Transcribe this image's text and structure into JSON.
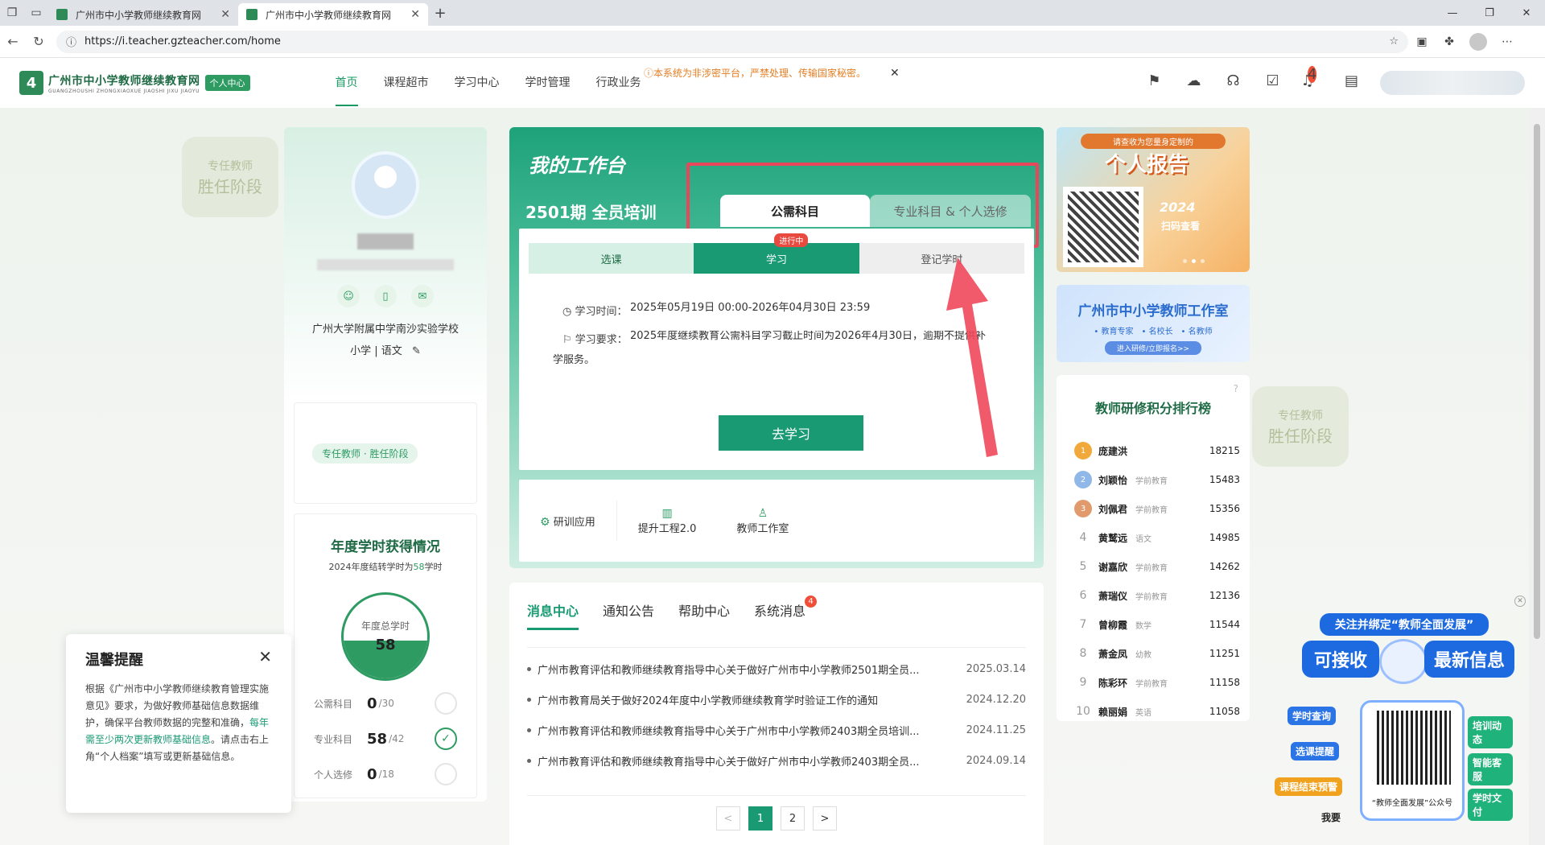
{
  "browser": {
    "tabs": [
      {
        "title": "广州市中小学教师继续教育网"
      },
      {
        "title": "广州市中小学教师继续教育网"
      }
    ],
    "url": "https://i.teacher.gzteacher.com/home"
  },
  "header": {
    "logo_cn": "广州市中小学教师继续教育网",
    "logo_en": "GUANGZHOUSHI ZHONGXIAOXUE JIAOSHI JIXU JIAOYU",
    "badge": "个人中心",
    "nav": [
      {
        "label": "首页",
        "active": true
      },
      {
        "label": "课程超市"
      },
      {
        "label": "学习中心"
      },
      {
        "label": "学时管理"
      },
      {
        "label": "行政业务"
      }
    ],
    "notice": "本系统为非涉密平台，严禁处理、传输国家秘密。",
    "notif_count": "4"
  },
  "watermark": {
    "line1": "专任教师",
    "line2": "胜任阶段"
  },
  "profile": {
    "school": "广州大学附属中学南沙实验学校",
    "subject": "小学 | 语文",
    "stage": "专任教师 · 胜任阶段",
    "annual_title": "年度学时获得情况",
    "annual_sub_prefix": "2024年度结转学时为",
    "annual_sub_value": "58",
    "annual_sub_suffix": "学时",
    "total_label": "年度总学时",
    "total_value": "58",
    "stats": [
      {
        "label": "公需科目",
        "value": "0",
        "total": "/30",
        "done": false
      },
      {
        "label": "专业科目",
        "value": "58",
        "total": "/42",
        "done": true
      },
      {
        "label": "个人选修",
        "value": "0",
        "total": "/18",
        "done": false
      }
    ]
  },
  "workspace": {
    "title": "我的工作台",
    "period": "2501期 全员培训",
    "tab_public": "公需科目",
    "tab_prof": "专业科目 & 个人选修",
    "in_progress": "进行中",
    "steps": [
      "选课",
      "学习",
      "登记学时"
    ],
    "study_time_label": "学习时间：",
    "study_time": "2025年05月19日 00:00-2026年04月30日 23:59",
    "req_label": "学习要求：",
    "req_text": "2025年度继续教育公需科目学习截止时间为2026年4月30日，逾期不提供补",
    "req_wrap": "学服务。",
    "go_button": "去学习",
    "apps": [
      "研训应用",
      "提升工程2.0",
      "教师工作室"
    ]
  },
  "messages": {
    "tabs": [
      {
        "label": "消息中心",
        "active": true
      },
      {
        "label": "通知公告"
      },
      {
        "label": "帮助中心"
      },
      {
        "label": "系统消息",
        "badge": "4"
      }
    ],
    "items": [
      {
        "title": "广州市教育评估和教师继续教育指导中心关于做好广州市中小学教师2501期全员...",
        "date": "2025.03.14"
      },
      {
        "title": "广州市教育局关于做好2024年度中小学教师继续教育学时验证工作的通知",
        "date": "2024.12.20"
      },
      {
        "title": "广州市教育评估和教师继续教育指导中心关于广州市中小学教师2403期全员培训...",
        "date": "2024.11.25"
      },
      {
        "title": "广州市教育评估和教师继续教育指导中心关于做好广州市中小学教师2403期全员...",
        "date": "2024.09.14"
      }
    ],
    "pager": {
      "prev": "<",
      "pages": [
        "1",
        "2"
      ],
      "next": ">"
    }
  },
  "right": {
    "report_top": "请查收为您量身定制的",
    "report_big": "个人报告",
    "report_year": "2024",
    "report_scan": "扫码查看",
    "studio_title": "广州市中小学教师工作室",
    "studio_tags": "• 教育专家　• 名校长　• 名教师",
    "studio_btn": "进入研修/立即报名>>",
    "rank_title": "教师研修积分排行榜",
    "rank": [
      {
        "n": "1",
        "name": "庞建洪",
        "sub": "",
        "score": "18215"
      },
      {
        "n": "2",
        "name": "刘颖怡",
        "sub": "学前教育",
        "score": "15483"
      },
      {
        "n": "3",
        "name": "刘佩君",
        "sub": "学前教育",
        "score": "15356"
      },
      {
        "n": "4",
        "name": "黄鹫远",
        "sub": "语文",
        "score": "14985"
      },
      {
        "n": "5",
        "name": "谢嘉欣",
        "sub": "学前教育",
        "score": "14262"
      },
      {
        "n": "6",
        "name": "萧瑞仪",
        "sub": "学前教育",
        "score": "12136"
      },
      {
        "n": "7",
        "name": "曾柳霞",
        "sub": "数学",
        "score": "11544"
      },
      {
        "n": "8",
        "name": "萧金凤",
        "sub": "幼教",
        "score": "11251"
      },
      {
        "n": "9",
        "name": "陈彩环",
        "sub": "学前教育",
        "score": "11158"
      },
      {
        "n": "10",
        "name": "赖丽娟",
        "sub": "英语",
        "score": "11058"
      }
    ]
  },
  "reminder": {
    "title": "温馨提醒",
    "body1": "根据《广州市中小学教师继续教育管理实施意见》要求，为做好教师基础信息数据维护，确保平台教师数据的完整和准确，",
    "body_hl": "每年需至少两次更新教师基础信息",
    "body2": "。请点击右上角“个人档案”填写或更新基础信息。"
  },
  "promo": {
    "top": "关注并绑定“教师全面发展”",
    "left": "可接收",
    "right": "最新信息",
    "caption": "“教师全面发展”公众号",
    "tags": [
      "学时查询",
      "选课提醒",
      "课程结束预警",
      "培训动态",
      "智能客服",
      "学时文付",
      "我要"
    ]
  }
}
